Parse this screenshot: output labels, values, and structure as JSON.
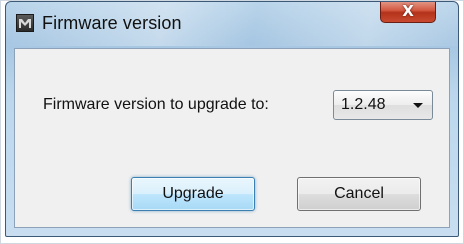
{
  "window": {
    "title": "Firmware version",
    "close_glyph": "X",
    "app_icon": "app-logo-icon"
  },
  "form": {
    "prompt_label": "Firmware version to upgrade to:",
    "version_select": {
      "selected_value": "1.2.48",
      "arrow_icon": "chevron-down-icon"
    }
  },
  "buttons": {
    "upgrade_label": "Upgrade",
    "cancel_label": "Cancel"
  },
  "colors": {
    "title_bar": "#b9d4ea",
    "close_button": "#c84a2f",
    "dialog_body": "#f0f0f0",
    "default_button_accent": "#3c7fb1"
  }
}
